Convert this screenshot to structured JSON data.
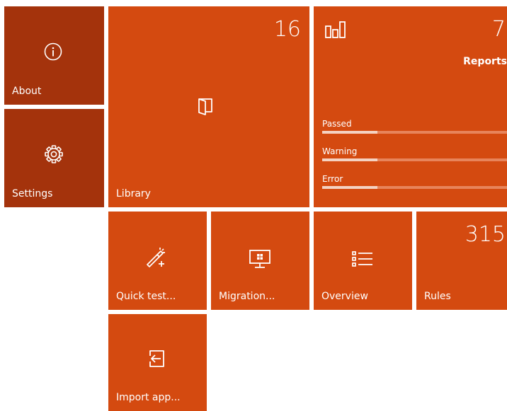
{
  "tiles": {
    "about": {
      "label": "About",
      "icon": "info-icon"
    },
    "settings": {
      "label": "Settings",
      "icon": "gear-icon"
    },
    "library": {
      "label": "Library",
      "count": "16",
      "icon": "book-icon"
    },
    "reports": {
      "label": "Reports",
      "count": "7",
      "icon": "bar-chart-icon",
      "stats": [
        {
          "label": "Passed",
          "fill": 0.3
        },
        {
          "label": "Warning",
          "fill": 0.3
        },
        {
          "label": "Error",
          "fill": 0.3
        }
      ]
    },
    "quick_test": {
      "label": "Quick test...",
      "icon": "magic-wand-icon"
    },
    "migration": {
      "label": "Migration...",
      "icon": "monitor-windows-icon"
    },
    "overview": {
      "label": "Overview",
      "icon": "list-icon"
    },
    "rules": {
      "label": "Rules",
      "count": "315"
    },
    "import_app": {
      "label": "Import app...",
      "icon": "import-icon"
    }
  },
  "colors": {
    "tile": "#d44a10",
    "tile_dark": "#a4330c",
    "bar_track": "#e7845b",
    "bar_fill": "#f4d2c2"
  }
}
